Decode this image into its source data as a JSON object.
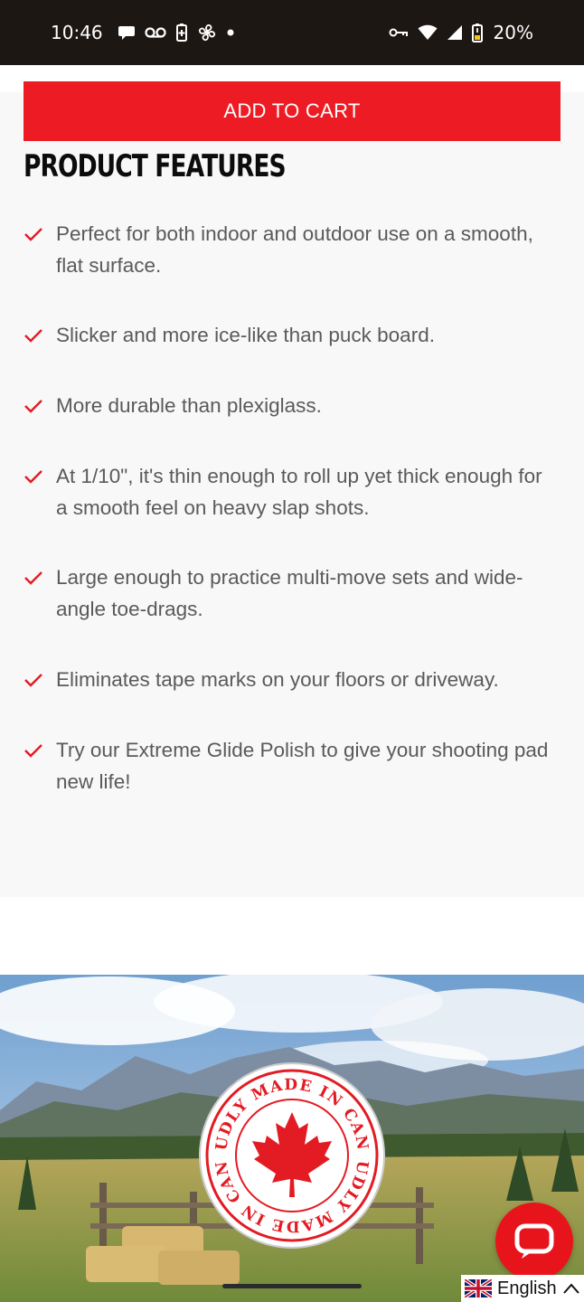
{
  "status_bar": {
    "time": "10:46",
    "battery": "20%",
    "left_icons": [
      "chat-bubble-icon",
      "voicemail-icon",
      "battery-saver-icon",
      "fan-icon",
      "dot-icon"
    ],
    "right_icons": [
      "vpn-key-icon",
      "wifi-icon",
      "signal-icon",
      "battery-icon"
    ]
  },
  "cart": {
    "add_to_cart_label": "ADD TO CART",
    "button_color": "#ed1c24"
  },
  "features": {
    "title": "PRODUCT FEATURES",
    "check_color": "#e31b23",
    "items": [
      {
        "line1": "Perfect for both indoor and outdoor use on a smooth,",
        "line2": "flat surface."
      },
      {
        "line1": "Slicker and more ice-like than puck board.",
        "line2": ""
      },
      {
        "line1": "More durable than plexiglass.",
        "line2": ""
      },
      {
        "line1": "At 1/10\", it's thin enough to roll up yet thick enough for",
        "line2": "a smooth feel on heavy slap shots."
      },
      {
        "line1": "Large enough to practice multi-move sets and wide-",
        "line2": "angle toe-drags."
      },
      {
        "line1": "Eliminates tape marks on your floors or driveway.",
        "line2": ""
      },
      {
        "line1": "Try our Extreme Glide Polish to give your shooting pad",
        "line2": "new life!"
      }
    ]
  },
  "banner": {
    "badge_text_top": "PROUDLY MADE IN CANADA",
    "badge_text_bottom": "PROUDLY MADE IN CANADA",
    "badge_icon": "maple-leaf-icon"
  },
  "chat": {
    "icon": "chat-icon",
    "color": "#e8141c"
  },
  "language": {
    "label": "English",
    "flag_icon": "uk-flag-icon",
    "chevron_icon": "chevron-up-icon"
  }
}
